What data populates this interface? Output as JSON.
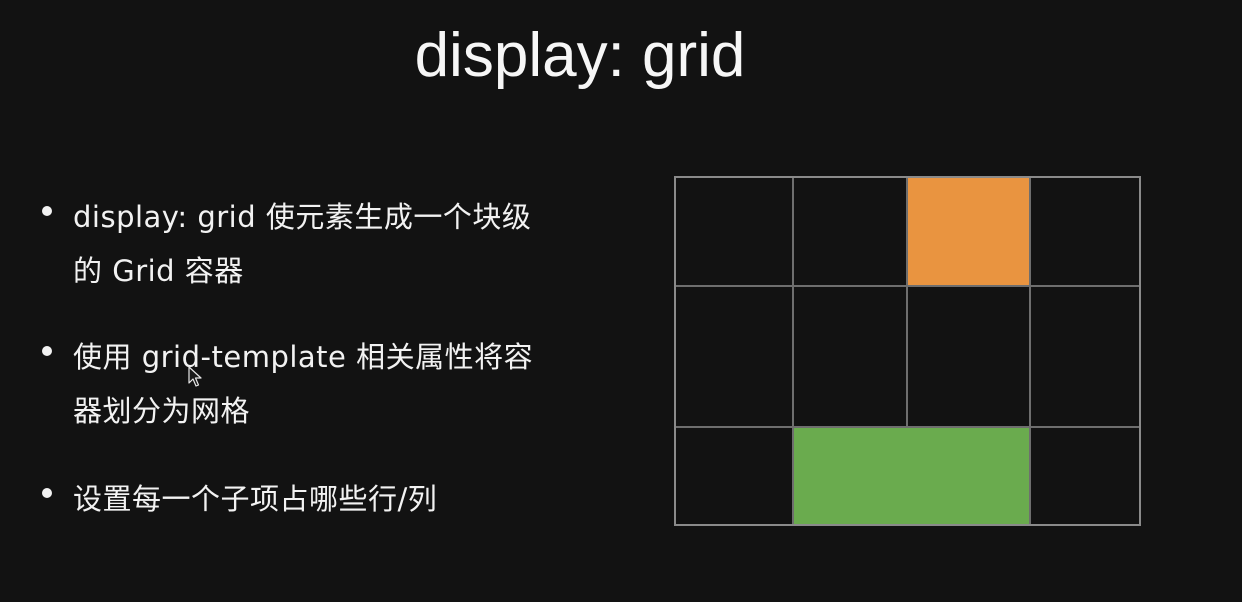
{
  "slide": {
    "title": "display: grid",
    "bullets": [
      {
        "line1": "display: grid 使元素生成一个块级",
        "line2": "的 Grid 容器"
      },
      {
        "line1": "使用 grid-template 相关属性将容",
        "line2": "器划分为网格"
      },
      {
        "line1": "设置每一个子项占哪些行/列",
        "line2": ""
      }
    ]
  },
  "grid_demo": {
    "rows": 3,
    "columns": 4,
    "items": [
      {
        "name": "orange-item",
        "color": "#E99440",
        "row": "1",
        "column": "3"
      },
      {
        "name": "green-item",
        "color": "#6AAB4E",
        "row": "3",
        "column": "2 / 4"
      }
    ],
    "line_color": "#8a8a8a"
  },
  "cursor": {
    "icon": "mouse-pointer-icon"
  }
}
